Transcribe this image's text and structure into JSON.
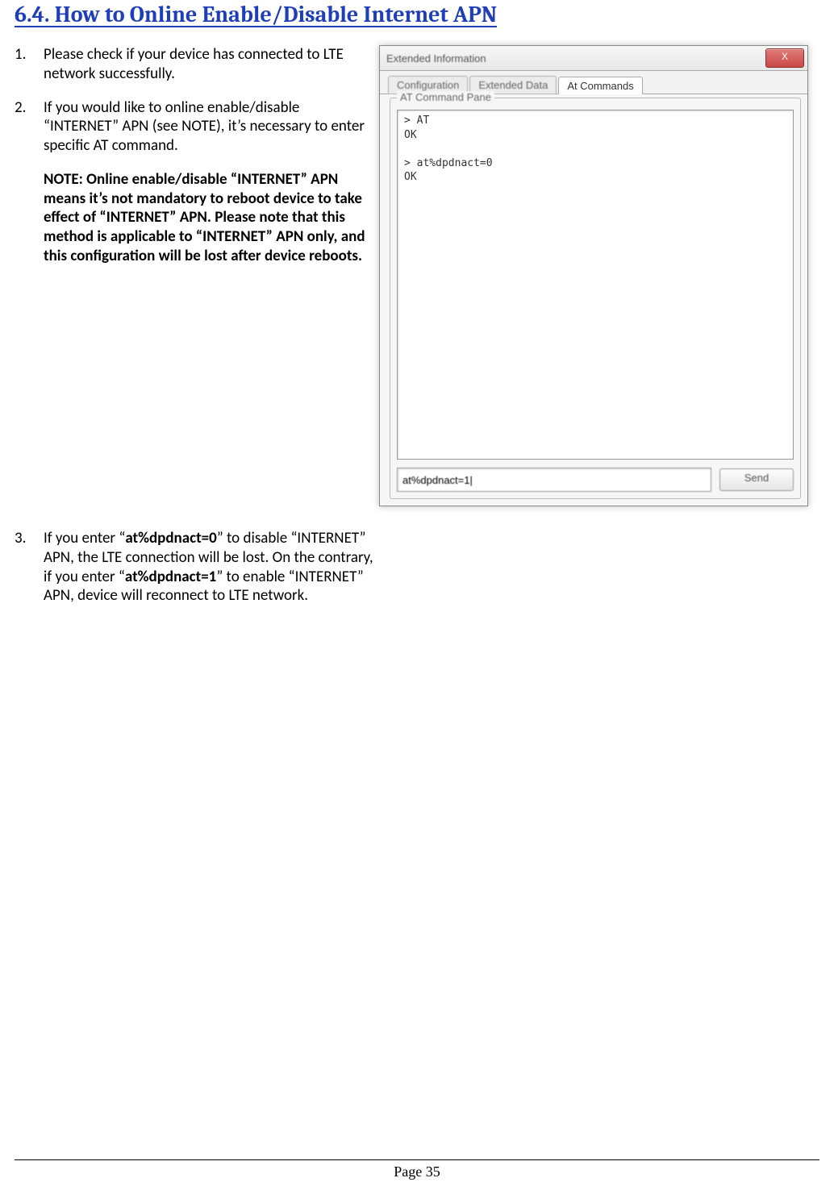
{
  "heading": "6.4. How to Online Enable/Disable Internet APN",
  "steps": {
    "s1": {
      "num": "1.",
      "text": "Please check if your device has connected to LTE network successfully."
    },
    "s2": {
      "num": "2.",
      "text": "If you would like to online enable/disable “INTERNET” APN (see NOTE), it’s necessary to enter specific AT command."
    },
    "note": "NOTE: Online enable/disable “INTERNET” APN means it’s not mandatory to reboot device to take effect of “INTERNET” APN. Please note that this method is applicable to “INTERNET” APN only, and this configuration will be lost after device reboots.",
    "s3": {
      "num": "3.",
      "pre": "If you enter “",
      "cmd0": "at%dpdnact=0",
      "mid1": "” to disable “INTERNET” APN, the LTE connection will be lost. On the contrary, if you enter “",
      "cmd1": "at%dpdnact=1",
      "mid2": "” to enable “INTERNET” APN, device will reconnect to LTE network."
    }
  },
  "window": {
    "title": "Extended Information",
    "close": "X",
    "tabs": {
      "t1": "Configuration",
      "t2": "Extended Data",
      "t3": "At Commands"
    },
    "group_label": "AT Command Pane",
    "output": "> AT\nOK\n\n> at%dpdnact=0\nOK",
    "input_value": "at%dpdnact=1|",
    "send": "Send"
  },
  "footer": "Page 35"
}
